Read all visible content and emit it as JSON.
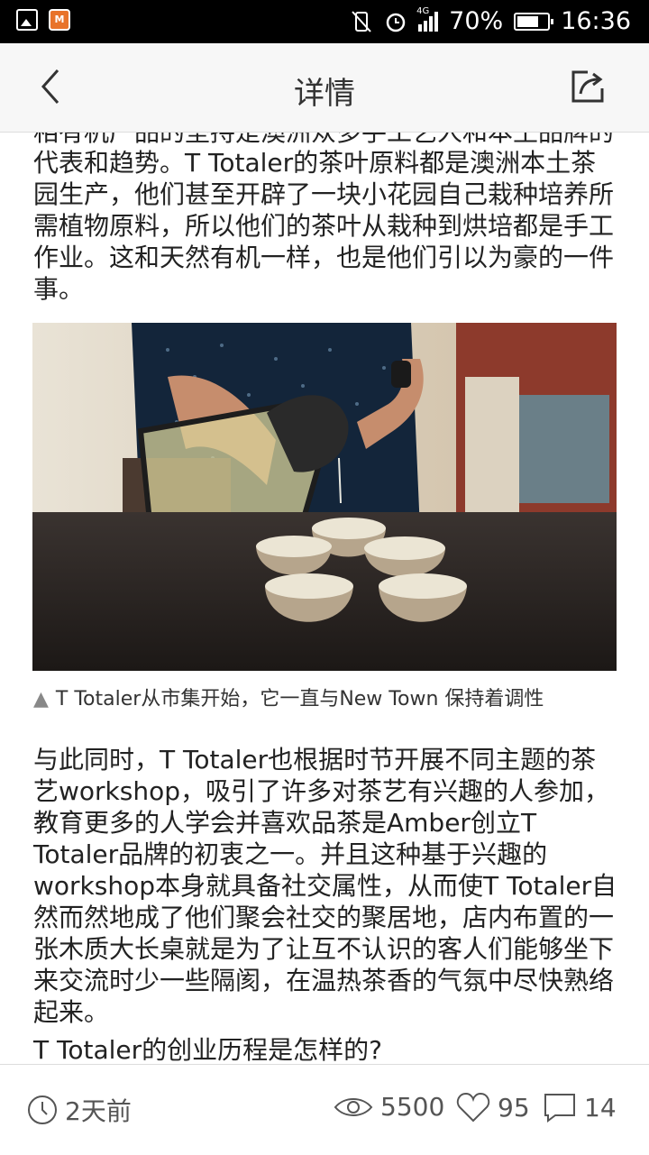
{
  "status_bar": {
    "network": "4G",
    "battery_percent": "70%",
    "battery_level": 0.7,
    "time": "16:36"
  },
  "nav": {
    "title": "详情"
  },
  "article": {
    "paragraph1_top_partial": "相有机产品的坚持是澳洲众多手工艺人和本土品牌的",
    "paragraph1": "代表和趋势。T Totaler的茶叶原料都是澳洲本土茶园生产，他们甚至开辟了一块小花园自己栽种培养所需植物原料，所以他们的茶叶从栽种到烘培都是手工作业。这和天然有机一样，也是他们引以为豪的一件事。",
    "image_caption_marker": "▲",
    "image_caption": "T Totaler从市集开始，它一直与New Town 保持着调性",
    "paragraph2": "与此同时，T Totaler也根据时节开展不同主题的茶艺workshop，吸引了许多对茶艺有兴趣的人参加，教育更多的人学会并喜欢品茶是Amber创立T Totaler品牌的初衷之一。并且这种基于兴趣的workshop本身就具备社交属性，从而使T Totaler自然而然地成了他们聚会社交的聚居地，店内布置的一张木质大长桌就是为了让互不认识的客人们能够坐下来交流时少一些隔阂，在温热茶香的气氛中尽快熟络起来。",
    "heading": "T Totaler的创业历程是怎样的?"
  },
  "footer": {
    "time_ago": "2天前",
    "views": "5500",
    "likes": "95",
    "comments": "14"
  },
  "icons": {
    "back": "chevron-left-icon",
    "share": "share-icon",
    "clock": "clock-icon",
    "views": "eye-icon",
    "likes": "heart-icon",
    "comments": "comment-icon"
  }
}
